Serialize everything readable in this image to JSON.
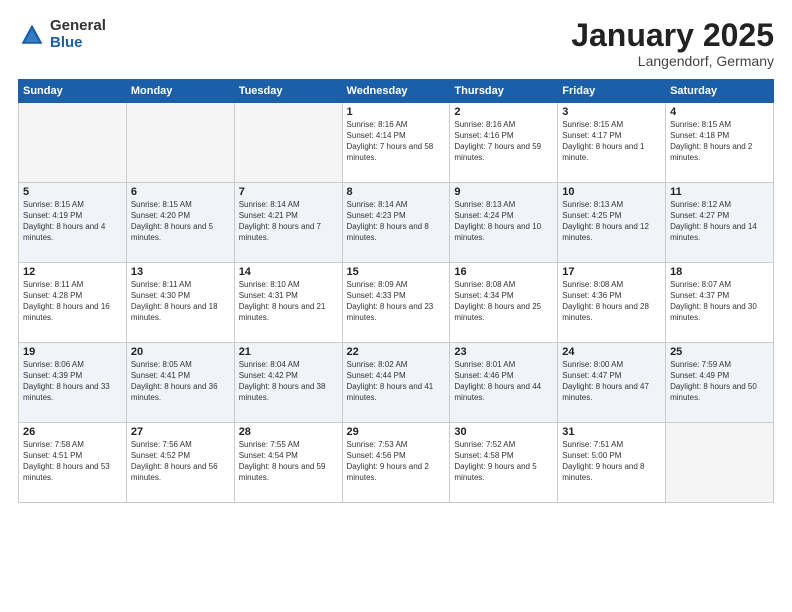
{
  "logo": {
    "general": "General",
    "blue": "Blue"
  },
  "title": "January 2025",
  "subtitle": "Langendorf, Germany",
  "days_of_week": [
    "Sunday",
    "Monday",
    "Tuesday",
    "Wednesday",
    "Thursday",
    "Friday",
    "Saturday"
  ],
  "weeks": [
    [
      {
        "day": "",
        "empty": true
      },
      {
        "day": "",
        "empty": true
      },
      {
        "day": "",
        "empty": true
      },
      {
        "day": "1",
        "sunrise": "8:16 AM",
        "sunset": "4:14 PM",
        "daylight": "7 hours and 58 minutes."
      },
      {
        "day": "2",
        "sunrise": "8:16 AM",
        "sunset": "4:16 PM",
        "daylight": "7 hours and 59 minutes."
      },
      {
        "day": "3",
        "sunrise": "8:15 AM",
        "sunset": "4:17 PM",
        "daylight": "8 hours and 1 minute."
      },
      {
        "day": "4",
        "sunrise": "8:15 AM",
        "sunset": "4:18 PM",
        "daylight": "8 hours and 2 minutes."
      }
    ],
    [
      {
        "day": "5",
        "sunrise": "8:15 AM",
        "sunset": "4:19 PM",
        "daylight": "8 hours and 4 minutes."
      },
      {
        "day": "6",
        "sunrise": "8:15 AM",
        "sunset": "4:20 PM",
        "daylight": "8 hours and 5 minutes."
      },
      {
        "day": "7",
        "sunrise": "8:14 AM",
        "sunset": "4:21 PM",
        "daylight": "8 hours and 7 minutes."
      },
      {
        "day": "8",
        "sunrise": "8:14 AM",
        "sunset": "4:23 PM",
        "daylight": "8 hours and 8 minutes."
      },
      {
        "day": "9",
        "sunrise": "8:13 AM",
        "sunset": "4:24 PM",
        "daylight": "8 hours and 10 minutes."
      },
      {
        "day": "10",
        "sunrise": "8:13 AM",
        "sunset": "4:25 PM",
        "daylight": "8 hours and 12 minutes."
      },
      {
        "day": "11",
        "sunrise": "8:12 AM",
        "sunset": "4:27 PM",
        "daylight": "8 hours and 14 minutes."
      }
    ],
    [
      {
        "day": "12",
        "sunrise": "8:11 AM",
        "sunset": "4:28 PM",
        "daylight": "8 hours and 16 minutes."
      },
      {
        "day": "13",
        "sunrise": "8:11 AM",
        "sunset": "4:30 PM",
        "daylight": "8 hours and 18 minutes."
      },
      {
        "day": "14",
        "sunrise": "8:10 AM",
        "sunset": "4:31 PM",
        "daylight": "8 hours and 21 minutes."
      },
      {
        "day": "15",
        "sunrise": "8:09 AM",
        "sunset": "4:33 PM",
        "daylight": "8 hours and 23 minutes."
      },
      {
        "day": "16",
        "sunrise": "8:08 AM",
        "sunset": "4:34 PM",
        "daylight": "8 hours and 25 minutes."
      },
      {
        "day": "17",
        "sunrise": "8:08 AM",
        "sunset": "4:36 PM",
        "daylight": "8 hours and 28 minutes."
      },
      {
        "day": "18",
        "sunrise": "8:07 AM",
        "sunset": "4:37 PM",
        "daylight": "8 hours and 30 minutes."
      }
    ],
    [
      {
        "day": "19",
        "sunrise": "8:06 AM",
        "sunset": "4:39 PM",
        "daylight": "8 hours and 33 minutes."
      },
      {
        "day": "20",
        "sunrise": "8:05 AM",
        "sunset": "4:41 PM",
        "daylight": "8 hours and 36 minutes."
      },
      {
        "day": "21",
        "sunrise": "8:04 AM",
        "sunset": "4:42 PM",
        "daylight": "8 hours and 38 minutes."
      },
      {
        "day": "22",
        "sunrise": "8:02 AM",
        "sunset": "4:44 PM",
        "daylight": "8 hours and 41 minutes."
      },
      {
        "day": "23",
        "sunrise": "8:01 AM",
        "sunset": "4:46 PM",
        "daylight": "8 hours and 44 minutes."
      },
      {
        "day": "24",
        "sunrise": "8:00 AM",
        "sunset": "4:47 PM",
        "daylight": "8 hours and 47 minutes."
      },
      {
        "day": "25",
        "sunrise": "7:59 AM",
        "sunset": "4:49 PM",
        "daylight": "8 hours and 50 minutes."
      }
    ],
    [
      {
        "day": "26",
        "sunrise": "7:58 AM",
        "sunset": "4:51 PM",
        "daylight": "8 hours and 53 minutes."
      },
      {
        "day": "27",
        "sunrise": "7:56 AM",
        "sunset": "4:52 PM",
        "daylight": "8 hours and 56 minutes."
      },
      {
        "day": "28",
        "sunrise": "7:55 AM",
        "sunset": "4:54 PM",
        "daylight": "8 hours and 59 minutes."
      },
      {
        "day": "29",
        "sunrise": "7:53 AM",
        "sunset": "4:56 PM",
        "daylight": "9 hours and 2 minutes."
      },
      {
        "day": "30",
        "sunrise": "7:52 AM",
        "sunset": "4:58 PM",
        "daylight": "9 hours and 5 minutes."
      },
      {
        "day": "31",
        "sunrise": "7:51 AM",
        "sunset": "5:00 PM",
        "daylight": "9 hours and 8 minutes."
      },
      {
        "day": "",
        "empty": true
      }
    ]
  ]
}
